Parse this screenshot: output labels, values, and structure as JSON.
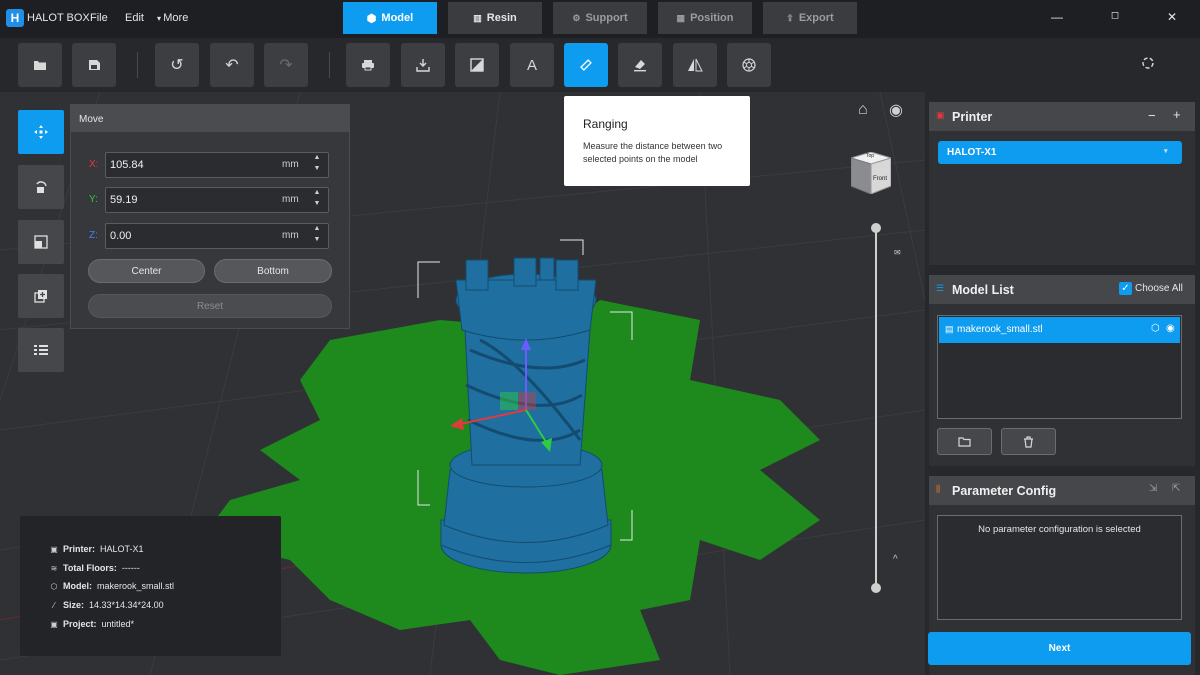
{
  "app": {
    "logo_letter": "H",
    "title": "HALOT BOX"
  },
  "menu": {
    "file": "File",
    "edit": "Edit",
    "more": "More"
  },
  "steps": [
    {
      "label": "Model",
      "state": "active"
    },
    {
      "label": "Resin",
      "state": "done"
    },
    {
      "label": "Support",
      "state": "disabled"
    },
    {
      "label": "Position",
      "state": "disabled"
    },
    {
      "label": "Export",
      "state": "disabled"
    }
  ],
  "toolbar": {
    "tools": [
      "open-folder-icon",
      "save-icon",
      "history-icon",
      "undo-icon",
      "redo-icon",
      "print-icon",
      "import-icon",
      "hollow-icon",
      "text-icon",
      "ruler-icon",
      "eraser-icon",
      "mirror-icon",
      "hexagon-icon"
    ],
    "active_tool": "ruler-icon",
    "text_tool_label": "A"
  },
  "move_panel": {
    "title": "Move",
    "x_label": "X:",
    "x_value": "105.84",
    "y_label": "Y:",
    "y_value": "59.19",
    "z_label": "Z:",
    "z_value": "0.00",
    "unit": "mm",
    "center_label": "Center",
    "bottom_label": "Bottom",
    "reset_label": "Reset"
  },
  "tooltip": {
    "title": "Ranging",
    "description": "Measure the distance between two selected points on the model"
  },
  "view_cube": {
    "top_label": "Top",
    "front_label": "Front"
  },
  "info": {
    "printer_label": "Printer:",
    "printer_value": "HALOT-X1",
    "floors_label": "Total Floors:",
    "floors_value": "------",
    "model_label": "Model:",
    "model_value": "makerook_small.stl",
    "size_label": "Size:",
    "size_value": "14.33*14.34*24.00",
    "project_label": "Project:",
    "project_value": "untitled*"
  },
  "printer_section": {
    "title": "Printer",
    "selected": "HALOT-X1"
  },
  "model_list": {
    "title": "Model List",
    "choose_all_label": "Choose All",
    "items": [
      "makerook_small.stl"
    ]
  },
  "parameter_config": {
    "title": "Parameter Config",
    "empty_text": "No parameter configuration is selected"
  },
  "next_label": "Next",
  "colors": {
    "accent": "#0e9cf0",
    "model": "#1f6fa0",
    "plate": "#1e8a1e",
    "x_axis": "#e23a3a",
    "y_axis": "#2ecc40",
    "z_axis": "#6a5cff"
  }
}
